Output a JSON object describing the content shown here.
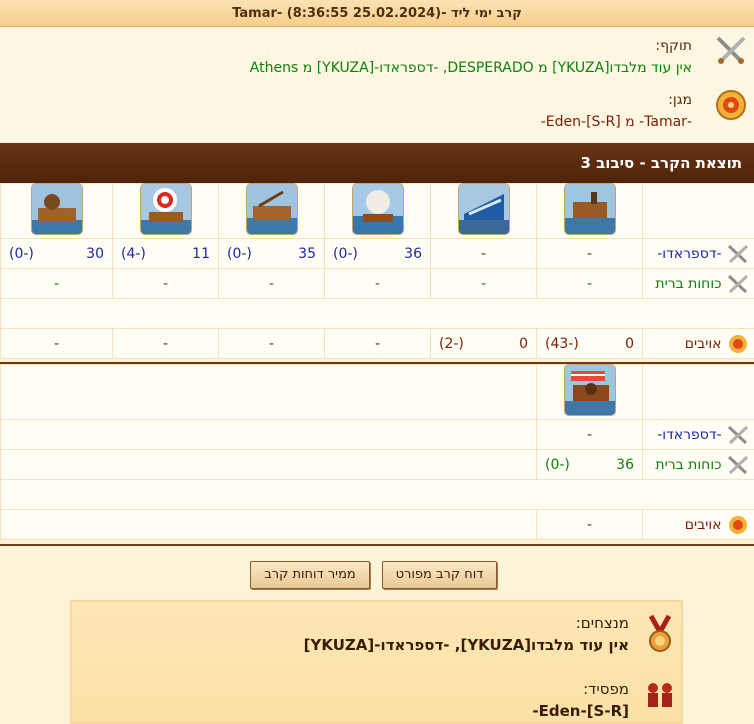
{
  "header": {
    "title": "קרב ימי ליד -(25.02.2024 8:36:55) -Tamar"
  },
  "attacker": {
    "label": "תוקף:",
    "value": "אין עוד מלבדו[YKUZA] מ DESPERADO, -דספראדו-[YKUZA] מ Athens"
  },
  "defender": {
    "label": "מגן:",
    "value": "-Tamar- מ Eden-[S-R]-"
  },
  "result_title": "תוצאת הקרב - סיבוב 3",
  "section1": {
    "rows": [
      {
        "name": "-דספראדו-",
        "cells": [
          "-",
          "-",
          "36|(0-)",
          "35|(0-)",
          "11|(4-)",
          "30|(0-)"
        ]
      },
      {
        "name": "כוחות ברית",
        "cells": [
          "-",
          "-",
          "-",
          "-",
          "-",
          "-"
        ]
      },
      {
        "name": "אויבים",
        "cells": [
          "(43-)|0",
          "0|(2-)",
          "-",
          "-",
          "-",
          "-"
        ]
      }
    ]
  },
  "section2": {
    "rows": [
      {
        "name": "-דספראדו-",
        "cells": [
          "-"
        ]
      },
      {
        "name": "כוחות ברית",
        "cells": [
          "36|(0-)"
        ]
      },
      {
        "name": "אויבים",
        "cells": [
          "-"
        ]
      }
    ]
  },
  "buttons": {
    "detailed": "דוח קרב מפורט",
    "converter": "ממיר דוחות קרב"
  },
  "outcome": {
    "winners_label": "מנצחים:",
    "winners_value": "אין עוד מלבדו[YKUZA], -דספראדו-[YKUZA]",
    "loser_label": "מפסיד:",
    "loser_value": "Eden-[S-R]-"
  }
}
